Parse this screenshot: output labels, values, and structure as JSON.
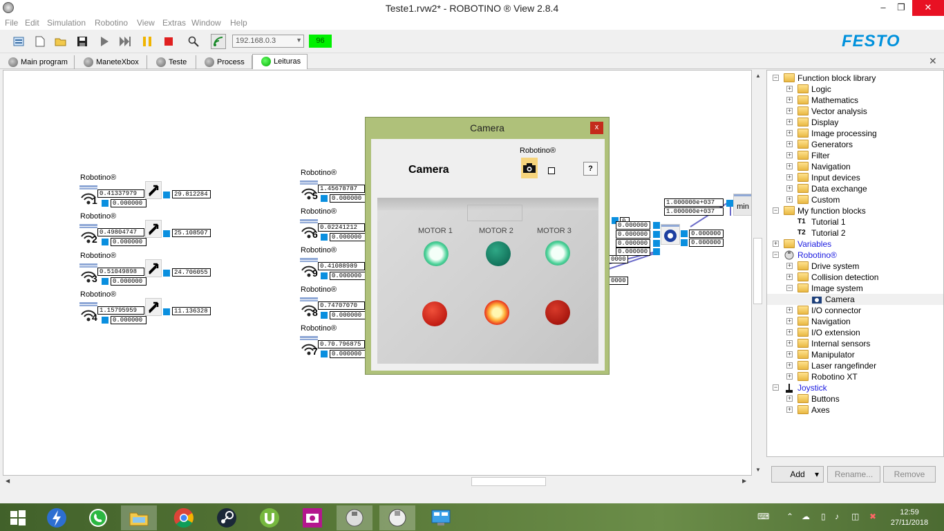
{
  "window": {
    "title": "Teste1.rvw2* - ROBOTINO ® View 2.8.4",
    "minimize": "–",
    "maximize": "❐",
    "close": "✕"
  },
  "menu": [
    "File",
    "Edit",
    "Simulation",
    "Robotino",
    "View",
    "Extras",
    "Window",
    "Help"
  ],
  "toolbar": {
    "ip_address": "192.168.0.3",
    "signal_value": "96",
    "brand": "FESTO",
    "buttons": [
      "properties-icon",
      "new-icon",
      "open-icon",
      "save-icon",
      "play-icon",
      "step-icon",
      "pause-icon",
      "stop-icon",
      "search-icon",
      "connect-icon"
    ]
  },
  "tabs": [
    {
      "label": "Main program",
      "active": false
    },
    {
      "label": "ManeteXbox",
      "active": false
    },
    {
      "label": "Teste",
      "active": false
    },
    {
      "label": "Process",
      "active": false
    },
    {
      "label": "Leituras",
      "active": true
    }
  ],
  "tab_close": "✕",
  "canvas": {
    "left_blocks": [
      {
        "label": "Robotino®",
        "num": "1",
        "in1": "0.413379",
        "in1_tail": "79",
        "in2": "0.000000",
        "out": "29.812284"
      },
      {
        "label": "Robotino®",
        "num": "2",
        "in1": "0.498047",
        "in1_tail": "47",
        "in2": "0.000000",
        "out": "25.108507"
      },
      {
        "label": "Robotino®",
        "num": "3",
        "in1": "0.510498",
        "in1_tail": "98",
        "in2": "0.000000",
        "out": "24.706055"
      },
      {
        "label": "Robotino®",
        "num": "4",
        "in1": "1.157959",
        "in1_tail": "59",
        "in2": "0.000000",
        "out": "11.136328"
      }
    ],
    "mid_blocks": [
      {
        "label": "Robotino®",
        "num": "5",
        "in1": "1.456787",
        "in1_tail": "87",
        "in2": "0.000000"
      },
      {
        "label": "Robotino®",
        "num": "6",
        "in1": "0.022412",
        "in1_tail": "12",
        "in2": "0.000000"
      },
      {
        "label": "Robotino®",
        "num": "9",
        "in1": "0.410889",
        "in1_tail": "89",
        "in2": "0.000000"
      },
      {
        "label": "Robotino®",
        "num": "8",
        "in1": "0.747070",
        "in1_tail": "70",
        "in2": "0.000000"
      },
      {
        "label": "Robotino®",
        "num": "7",
        "in1": "0.796875",
        "in1_tail": "0.7",
        "in2": "0.000000"
      }
    ],
    "right_values": {
      "top1": "1.000000e+037",
      "top2": "1.000000e+037",
      "min_label": "min",
      "zero_small": "0",
      "col_a": [
        "0.000000",
        "0.000000",
        "0.000000",
        "0.000000"
      ],
      "col_b": [
        "0.000000",
        "0.000000"
      ],
      "lower": "0000",
      "lower2": "0000"
    }
  },
  "camera_dialog": {
    "title": "Camera",
    "close": "x",
    "heading": "Camera",
    "robotino_label": "Robotino®",
    "help": "?",
    "motor_labels": [
      "MOTOR 1",
      "MOTOR 2",
      "MOTOR 3"
    ],
    "lamp_colors": {
      "green_on": "#e8fff0",
      "green_off": "#1b8a6b",
      "red_on": "#ffd36b",
      "red_off": "#c8201a"
    }
  },
  "tree": {
    "items": [
      {
        "label": "Function block library",
        "level": 0,
        "exp": "−",
        "type": "folder",
        "blue": false
      },
      {
        "label": "Logic",
        "level": 1,
        "exp": "+",
        "type": "folder",
        "blue": false
      },
      {
        "label": "Mathematics",
        "level": 1,
        "exp": "+",
        "type": "folder",
        "blue": false
      },
      {
        "label": "Vector analysis",
        "level": 1,
        "exp": "+",
        "type": "folder",
        "blue": false
      },
      {
        "label": "Display",
        "level": 1,
        "exp": "+",
        "type": "folder",
        "blue": false
      },
      {
        "label": "Image processing",
        "level": 1,
        "exp": "+",
        "type": "folder",
        "blue": false
      },
      {
        "label": "Generators",
        "level": 1,
        "exp": "+",
        "type": "folder",
        "blue": false
      },
      {
        "label": "Filter",
        "level": 1,
        "exp": "+",
        "type": "folder",
        "blue": false
      },
      {
        "label": "Navigation",
        "level": 1,
        "exp": "+",
        "type": "folder",
        "blue": false
      },
      {
        "label": "Input devices",
        "level": 1,
        "exp": "+",
        "type": "folder",
        "blue": false
      },
      {
        "label": "Data exchange",
        "level": 1,
        "exp": "+",
        "type": "folder",
        "blue": false
      },
      {
        "label": "Custom",
        "level": 1,
        "exp": "+",
        "type": "folder",
        "blue": false
      },
      {
        "label": "My function blocks",
        "level": 0,
        "exp": "−",
        "type": "folder",
        "blue": false
      },
      {
        "label": "Tutorial 1",
        "level": 1,
        "exp": "",
        "type": "T1",
        "blue": false
      },
      {
        "label": "Tutorial 2",
        "level": 1,
        "exp": "",
        "type": "T2",
        "blue": false
      },
      {
        "label": "Variables",
        "level": 0,
        "exp": "+",
        "type": "folder",
        "blue": true
      },
      {
        "label": "Robotino®",
        "level": 0,
        "exp": "−",
        "type": "robot",
        "blue": true
      },
      {
        "label": "Drive system",
        "level": 1,
        "exp": "+",
        "type": "folder",
        "blue": false
      },
      {
        "label": "Collision detection",
        "level": 1,
        "exp": "+",
        "type": "folder",
        "blue": false
      },
      {
        "label": "Image system",
        "level": 1,
        "exp": "−",
        "type": "folder",
        "blue": false
      },
      {
        "label": "Camera",
        "level": 2,
        "exp": "",
        "type": "camera",
        "blue": false
      },
      {
        "label": "I/O connector",
        "level": 1,
        "exp": "+",
        "type": "folder",
        "blue": false
      },
      {
        "label": "Navigation",
        "level": 1,
        "exp": "+",
        "type": "folder",
        "blue": false
      },
      {
        "label": "I/O extension",
        "level": 1,
        "exp": "+",
        "type": "folder",
        "blue": false
      },
      {
        "label": "Internal sensors",
        "level": 1,
        "exp": "+",
        "type": "folder",
        "blue": false
      },
      {
        "label": "Manipulator",
        "level": 1,
        "exp": "+",
        "type": "folder",
        "blue": false
      },
      {
        "label": "Laser rangefinder",
        "level": 1,
        "exp": "+",
        "type": "folder",
        "blue": false
      },
      {
        "label": "Robotino XT",
        "level": 1,
        "exp": "+",
        "type": "folder",
        "blue": false
      },
      {
        "label": "Joystick",
        "level": 0,
        "exp": "−",
        "type": "joystick",
        "blue": true
      },
      {
        "label": "Buttons",
        "level": 1,
        "exp": "+",
        "type": "folder",
        "blue": false
      },
      {
        "label": "Axes",
        "level": 1,
        "exp": "+",
        "type": "folder",
        "blue": false
      }
    ]
  },
  "panel_buttons": {
    "add": "Add",
    "add_arrow": "▾",
    "rename": "Rename...",
    "remove": "Remove"
  },
  "taskbar": {
    "icons": [
      "windows-start-icon",
      "lightning-app-icon",
      "whatsapp-icon",
      "file-explorer-icon",
      "chrome-icon",
      "steam-icon",
      "utorrent-icon",
      "camera-app-icon",
      "robotino-app-icon",
      "robotino-view-icon",
      "control-panel-icon"
    ],
    "time": "12:59",
    "date": "27/11/2018"
  }
}
